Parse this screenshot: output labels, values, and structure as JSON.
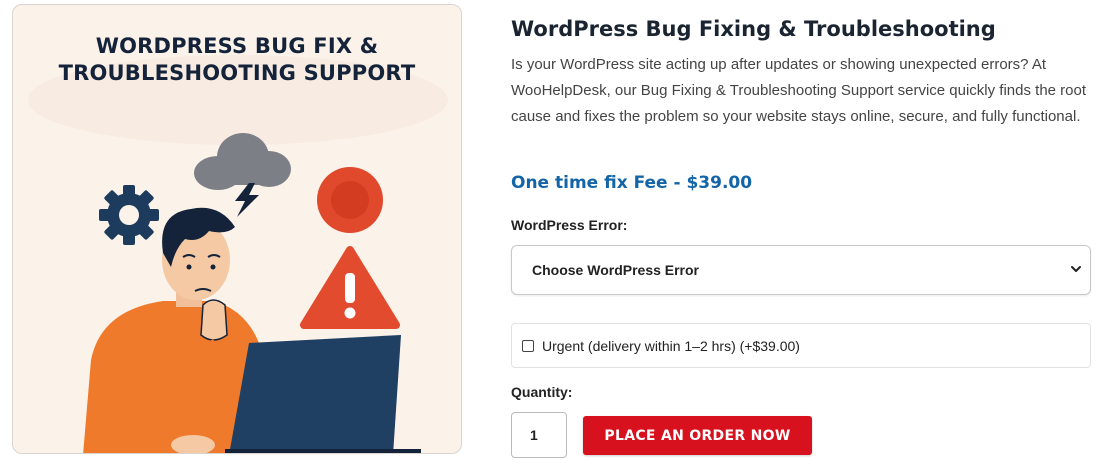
{
  "image": {
    "banner_line1": "WORDPRESS BUG FIX &",
    "banner_line2": "TROUBLESHOOTING SUPPORT",
    "icons": [
      "cloud-icon",
      "lightning-icon",
      "gear-icon",
      "record-button-icon",
      "warning-icon",
      "laptop-icon"
    ],
    "colors": {
      "background": "#fbf2ea",
      "shirt": "#f07a2b",
      "navy": "#14233a",
      "warning": "#e0492b"
    }
  },
  "product": {
    "title": "WordPress Bug Fixing & Troubleshooting",
    "description": "Is your WordPress site acting up after updates or showing unexpected errors? At WooHelpDesk, our Bug Fixing & Troubleshooting Support service quickly finds the root cause and fixes the problem so your website stays online, secure, and fully functional.",
    "price_text": "One time fix Fee - $39.00",
    "price_color": "#1465a8"
  },
  "form": {
    "error_label": "WordPress Error:",
    "error_select_value": "Choose WordPress Error",
    "urgent_label": "Urgent (delivery within 1–2 hrs) (+$39.00)",
    "urgent_checked": false,
    "quantity_label": "Quantity:",
    "quantity_value": "1",
    "order_button_label": "PLACE AN ORDER NOW",
    "order_button_color": "#d7111d"
  }
}
